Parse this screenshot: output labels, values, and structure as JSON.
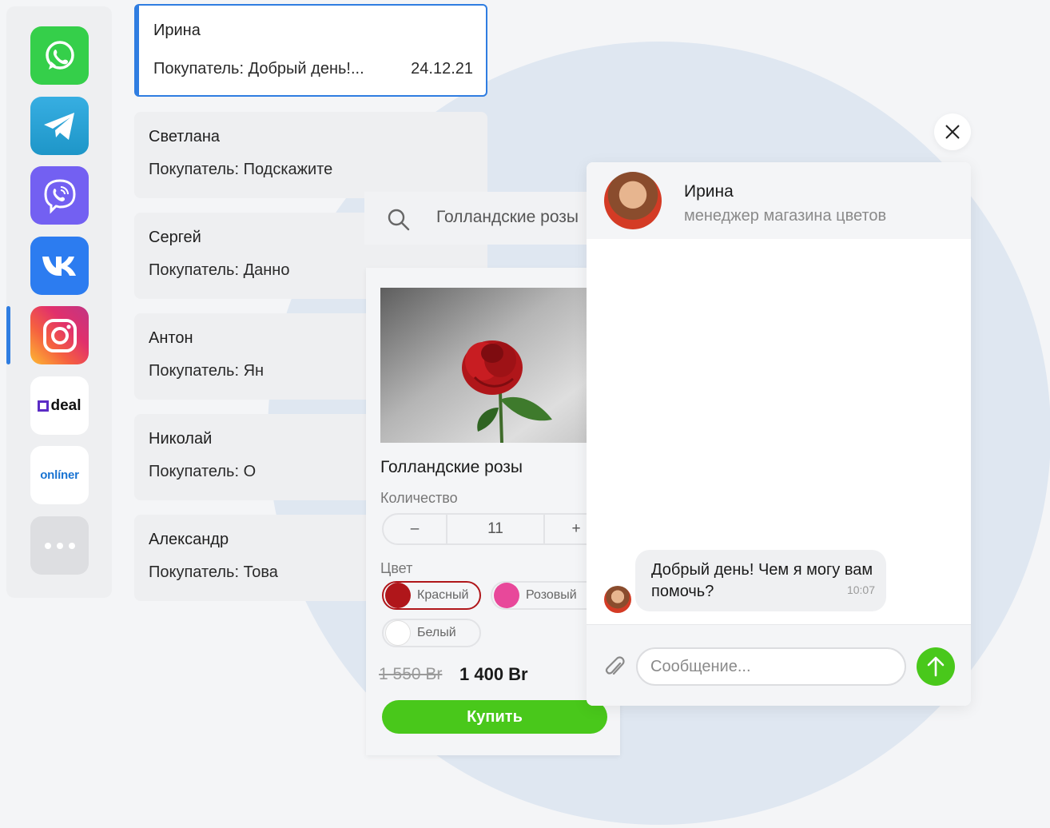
{
  "apps": [
    {
      "name": "whatsapp",
      "color": "#35cf4a"
    },
    {
      "name": "telegram",
      "color": "#2c9ae3"
    },
    {
      "name": "viber",
      "color": "#7360f2"
    },
    {
      "name": "vk",
      "color": "#2c7cf0"
    },
    {
      "name": "instagram",
      "color": "#e6335c",
      "active": true
    },
    {
      "name": "deal",
      "label": "deal"
    },
    {
      "name": "onliner",
      "label": "onlíner"
    },
    {
      "name": "more"
    }
  ],
  "chats": [
    {
      "name": "Ирина",
      "preview": "Покупатель: Добрый день!...",
      "date": "24.12.21",
      "active": true
    },
    {
      "name": "Светлана",
      "preview": "Покупатель: Подскажите"
    },
    {
      "name": "Сергей",
      "preview": "Покупатель: Данно"
    },
    {
      "name": "Антон",
      "preview": "Покупатель: Ян"
    },
    {
      "name": "Николай",
      "preview": "Покупатель: О"
    },
    {
      "name": "Александр",
      "preview": "Покупатель: Това"
    }
  ],
  "search": {
    "query": "Голландские розы"
  },
  "product": {
    "title": "Голландские розы",
    "quantity_label": "Количество",
    "quantity": "11",
    "minus": "–",
    "plus": "+",
    "color_label": "Цвет",
    "colors": [
      {
        "label": "Красный",
        "swatch": "#b0161a",
        "selected": true
      },
      {
        "label": "Розовый",
        "swatch": "#e8489a"
      },
      {
        "label": "Белый",
        "swatch": "#ffffff"
      }
    ],
    "old_price": "1 550 Br",
    "price": "1 400 Br",
    "buy_label": "Купить"
  },
  "chat_window": {
    "name": "Ирина",
    "role": "менеджер магазина цветов",
    "message": {
      "text": "Добрый день! Чем я могу вам помочь?",
      "time": "10:07"
    },
    "input_placeholder": "Сообщение...",
    "accent": "#49c81b"
  }
}
